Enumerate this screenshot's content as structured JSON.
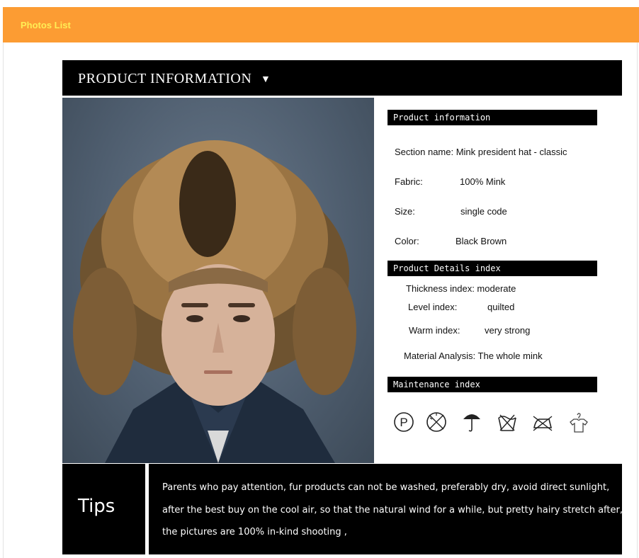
{
  "topbar": {
    "title": "Photos List"
  },
  "header": {
    "title": "PRODUCT  INFORMATION",
    "arrow": "▼"
  },
  "product_info": {
    "heading": "Product  information",
    "section_name": "Section name: Mink president hat - classic",
    "fabric_label": "Fabric:",
    "fabric_value": "100% Mink",
    "size_label": "Size:",
    "size_value": "single code",
    "color_label": "Color:",
    "color_value": "Black Brown"
  },
  "details": {
    "heading": "Product Details index",
    "thickness": "Thickness index: moderate",
    "level_label": "Level index:",
    "level_value": "quilted",
    "warm_label": "Warm index:",
    "warm_value": "very strong",
    "material": "Material Analysis: The whole mink"
  },
  "maintenance": {
    "heading": "Maintenance index",
    "icons": [
      "dry-clean-p-icon",
      "no-tumble-dry-icon",
      "no-sun-umbrella-icon",
      "no-wash-icon",
      "no-iron-icon",
      "hang-shirt-icon"
    ]
  },
  "tips": {
    "label": "Tips",
    "lines": [
      "Parents who pay attention, fur products can not be washed, preferably dry, avoid direct sunlight,",
      "after the best buy on the cool air, so that the natural wind for a while, but pretty hairy stretch after,",
      "the pictures are 100% in-kind shooting ,"
    ]
  },
  "colors": {
    "topbar": "#fc9c33",
    "topbar_text": "#ffee55",
    "bars": "#000000"
  }
}
